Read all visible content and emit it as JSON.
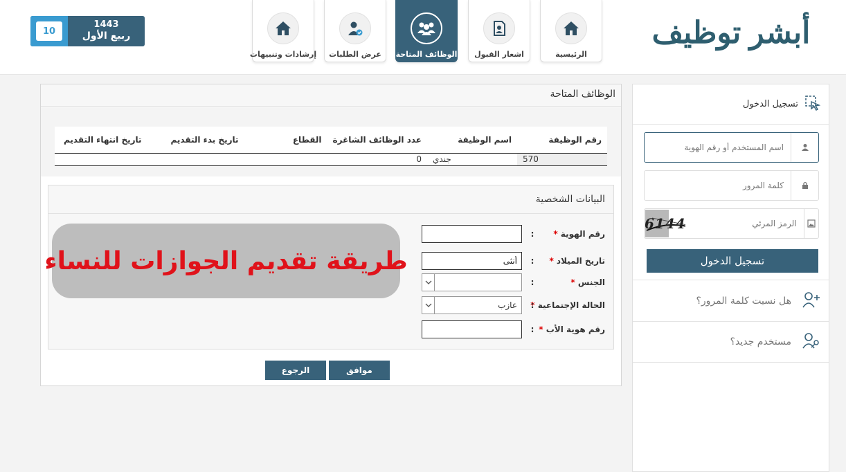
{
  "header": {
    "logo_text_1": "أبشر",
    "logo_text_2": "توظيف",
    "nav": [
      {
        "label": "الرئيسية",
        "icon": "home-icon"
      },
      {
        "label": "اشعار القبول",
        "icon": "acceptance-notice-icon"
      },
      {
        "label": "الوظائف المتاحة",
        "icon": "people-group-icon"
      },
      {
        "label": "عرض الطلبات",
        "icon": "user-check-icon"
      },
      {
        "label": "إرشادات وتنبيهات",
        "icon": "home-icon"
      }
    ],
    "active_nav": 2,
    "date": {
      "day": "10",
      "month": "ربيع الأول",
      "year": "1443"
    }
  },
  "main": {
    "title": "الوظائف المتاحة",
    "jobs_table": {
      "headers": [
        "رقم الوظيفة",
        "اسم الوظيفة",
        "عدد الوظائف الشاغرة",
        "القطاع",
        "تاريخ بدء التقديم",
        "تاريخ انتهاء التقديم"
      ],
      "rows": [
        [
          "570",
          "جندي",
          "0",
          "",
          "",
          ""
        ]
      ]
    },
    "personal": {
      "title": "البيانات الشخصية",
      "fields": [
        {
          "label": "رقم الهوية",
          "value": ""
        },
        {
          "label": "تاريخ الميلاد",
          "value": "أنثى"
        },
        {
          "label": "الجنس",
          "value": ""
        },
        {
          "label": "الحالة الإجتماعية",
          "value": "عازب"
        },
        {
          "label": "رقم هوية الأب",
          "value": ""
        }
      ],
      "required_mark": "*",
      "colon": ":"
    },
    "promo_text": "طريقة تقديم الجوازات للنساء",
    "buttons": {
      "back": "الرجوع",
      "agree": "موافق"
    }
  },
  "sidebar": {
    "title": "تسجيل الدخول",
    "username_placeholder": "اسم المستخدم أو رقم الهوية",
    "password_placeholder": "كلمة المرور",
    "captcha_placeholder": "الرمز المرئي",
    "captcha_code": "6144",
    "login_button": "تسجيل الدخول",
    "forgot_password": "هل نسيت كلمة المرور؟",
    "new_user": "مستخدم جديد؟"
  },
  "colors": {
    "primary": "#38627a",
    "date_accent": "#3a9bd0",
    "promo_bg": "#bdbdbd",
    "promo_text": "#e0121a",
    "required": "#dd0000"
  }
}
